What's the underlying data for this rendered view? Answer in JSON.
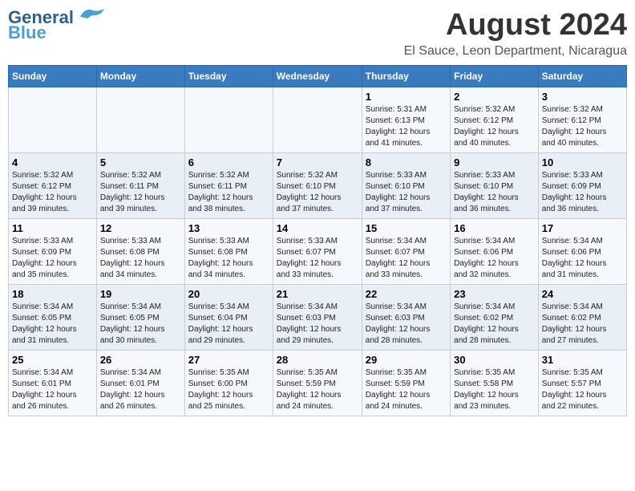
{
  "header": {
    "logo_line1": "General",
    "logo_line2": "Blue",
    "main_title": "August 2024",
    "subtitle": "El Sauce, Leon Department, Nicaragua"
  },
  "calendar": {
    "days_of_week": [
      "Sunday",
      "Monday",
      "Tuesday",
      "Wednesday",
      "Thursday",
      "Friday",
      "Saturday"
    ],
    "weeks": [
      [
        {
          "day": "",
          "info": ""
        },
        {
          "day": "",
          "info": ""
        },
        {
          "day": "",
          "info": ""
        },
        {
          "day": "",
          "info": ""
        },
        {
          "day": "1",
          "info": "Sunrise: 5:31 AM\nSunset: 6:13 PM\nDaylight: 12 hours\nand 41 minutes."
        },
        {
          "day": "2",
          "info": "Sunrise: 5:32 AM\nSunset: 6:12 PM\nDaylight: 12 hours\nand 40 minutes."
        },
        {
          "day": "3",
          "info": "Sunrise: 5:32 AM\nSunset: 6:12 PM\nDaylight: 12 hours\nand 40 minutes."
        }
      ],
      [
        {
          "day": "4",
          "info": "Sunrise: 5:32 AM\nSunset: 6:12 PM\nDaylight: 12 hours\nand 39 minutes."
        },
        {
          "day": "5",
          "info": "Sunrise: 5:32 AM\nSunset: 6:11 PM\nDaylight: 12 hours\nand 39 minutes."
        },
        {
          "day": "6",
          "info": "Sunrise: 5:32 AM\nSunset: 6:11 PM\nDaylight: 12 hours\nand 38 minutes."
        },
        {
          "day": "7",
          "info": "Sunrise: 5:32 AM\nSunset: 6:10 PM\nDaylight: 12 hours\nand 37 minutes."
        },
        {
          "day": "8",
          "info": "Sunrise: 5:33 AM\nSunset: 6:10 PM\nDaylight: 12 hours\nand 37 minutes."
        },
        {
          "day": "9",
          "info": "Sunrise: 5:33 AM\nSunset: 6:10 PM\nDaylight: 12 hours\nand 36 minutes."
        },
        {
          "day": "10",
          "info": "Sunrise: 5:33 AM\nSunset: 6:09 PM\nDaylight: 12 hours\nand 36 minutes."
        }
      ],
      [
        {
          "day": "11",
          "info": "Sunrise: 5:33 AM\nSunset: 6:09 PM\nDaylight: 12 hours\nand 35 minutes."
        },
        {
          "day": "12",
          "info": "Sunrise: 5:33 AM\nSunset: 6:08 PM\nDaylight: 12 hours\nand 34 minutes."
        },
        {
          "day": "13",
          "info": "Sunrise: 5:33 AM\nSunset: 6:08 PM\nDaylight: 12 hours\nand 34 minutes."
        },
        {
          "day": "14",
          "info": "Sunrise: 5:33 AM\nSunset: 6:07 PM\nDaylight: 12 hours\nand 33 minutes."
        },
        {
          "day": "15",
          "info": "Sunrise: 5:34 AM\nSunset: 6:07 PM\nDaylight: 12 hours\nand 33 minutes."
        },
        {
          "day": "16",
          "info": "Sunrise: 5:34 AM\nSunset: 6:06 PM\nDaylight: 12 hours\nand 32 minutes."
        },
        {
          "day": "17",
          "info": "Sunrise: 5:34 AM\nSunset: 6:06 PM\nDaylight: 12 hours\nand 31 minutes."
        }
      ],
      [
        {
          "day": "18",
          "info": "Sunrise: 5:34 AM\nSunset: 6:05 PM\nDaylight: 12 hours\nand 31 minutes."
        },
        {
          "day": "19",
          "info": "Sunrise: 5:34 AM\nSunset: 6:05 PM\nDaylight: 12 hours\nand 30 minutes."
        },
        {
          "day": "20",
          "info": "Sunrise: 5:34 AM\nSunset: 6:04 PM\nDaylight: 12 hours\nand 29 minutes."
        },
        {
          "day": "21",
          "info": "Sunrise: 5:34 AM\nSunset: 6:03 PM\nDaylight: 12 hours\nand 29 minutes."
        },
        {
          "day": "22",
          "info": "Sunrise: 5:34 AM\nSunset: 6:03 PM\nDaylight: 12 hours\nand 28 minutes."
        },
        {
          "day": "23",
          "info": "Sunrise: 5:34 AM\nSunset: 6:02 PM\nDaylight: 12 hours\nand 28 minutes."
        },
        {
          "day": "24",
          "info": "Sunrise: 5:34 AM\nSunset: 6:02 PM\nDaylight: 12 hours\nand 27 minutes."
        }
      ],
      [
        {
          "day": "25",
          "info": "Sunrise: 5:34 AM\nSunset: 6:01 PM\nDaylight: 12 hours\nand 26 minutes."
        },
        {
          "day": "26",
          "info": "Sunrise: 5:34 AM\nSunset: 6:01 PM\nDaylight: 12 hours\nand 26 minutes."
        },
        {
          "day": "27",
          "info": "Sunrise: 5:35 AM\nSunset: 6:00 PM\nDaylight: 12 hours\nand 25 minutes."
        },
        {
          "day": "28",
          "info": "Sunrise: 5:35 AM\nSunset: 5:59 PM\nDaylight: 12 hours\nand 24 minutes."
        },
        {
          "day": "29",
          "info": "Sunrise: 5:35 AM\nSunset: 5:59 PM\nDaylight: 12 hours\nand 24 minutes."
        },
        {
          "day": "30",
          "info": "Sunrise: 5:35 AM\nSunset: 5:58 PM\nDaylight: 12 hours\nand 23 minutes."
        },
        {
          "day": "31",
          "info": "Sunrise: 5:35 AM\nSunset: 5:57 PM\nDaylight: 12 hours\nand 22 minutes."
        }
      ]
    ]
  }
}
